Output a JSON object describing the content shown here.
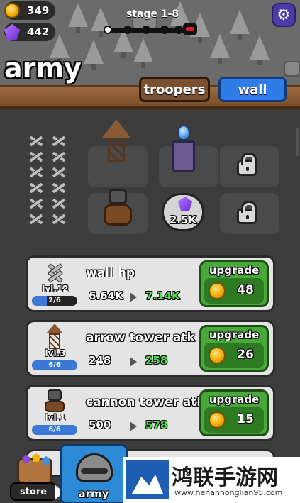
{
  "resources": {
    "coins": "349",
    "gems": "442"
  },
  "stage": {
    "label": "stage 1-8"
  },
  "title": "army",
  "tabs": [
    {
      "label": "troopers",
      "active": false
    },
    {
      "label": "wall",
      "active": true
    }
  ],
  "purchase": {
    "gem_cost": "2.5K"
  },
  "upgrades": [
    {
      "name": "wall hp",
      "level": "lvl.12",
      "progress_text": "2/6",
      "progress": 0.33,
      "current": "6.64K",
      "next": "7.14K",
      "button_label": "upgrade",
      "cost": "48",
      "icon": "wall-icon"
    },
    {
      "name": "arrow tower atk",
      "level": "lvl.3",
      "progress_text": "6/6",
      "progress": 1.0,
      "current": "248",
      "next": "258",
      "button_label": "upgrade",
      "cost": "26",
      "icon": "arrow-tower-icon"
    },
    {
      "name": "cannon tower atk",
      "level": "lvl.1",
      "progress_text": "6/6",
      "progress": 1.0,
      "current": "500",
      "next": "578",
      "button_label": "upgrade",
      "cost": "15",
      "icon": "cannon-tower-icon"
    }
  ],
  "nav": {
    "store_label": "store",
    "army_label": "army"
  },
  "watermark": {
    "text": "鸿联手游网",
    "url": "www.henanhonglian95.com"
  },
  "colors": {
    "accent_blue": "#2f7be8",
    "upgrade_green": "#48a93a",
    "next_value_green": "#4be04b"
  }
}
